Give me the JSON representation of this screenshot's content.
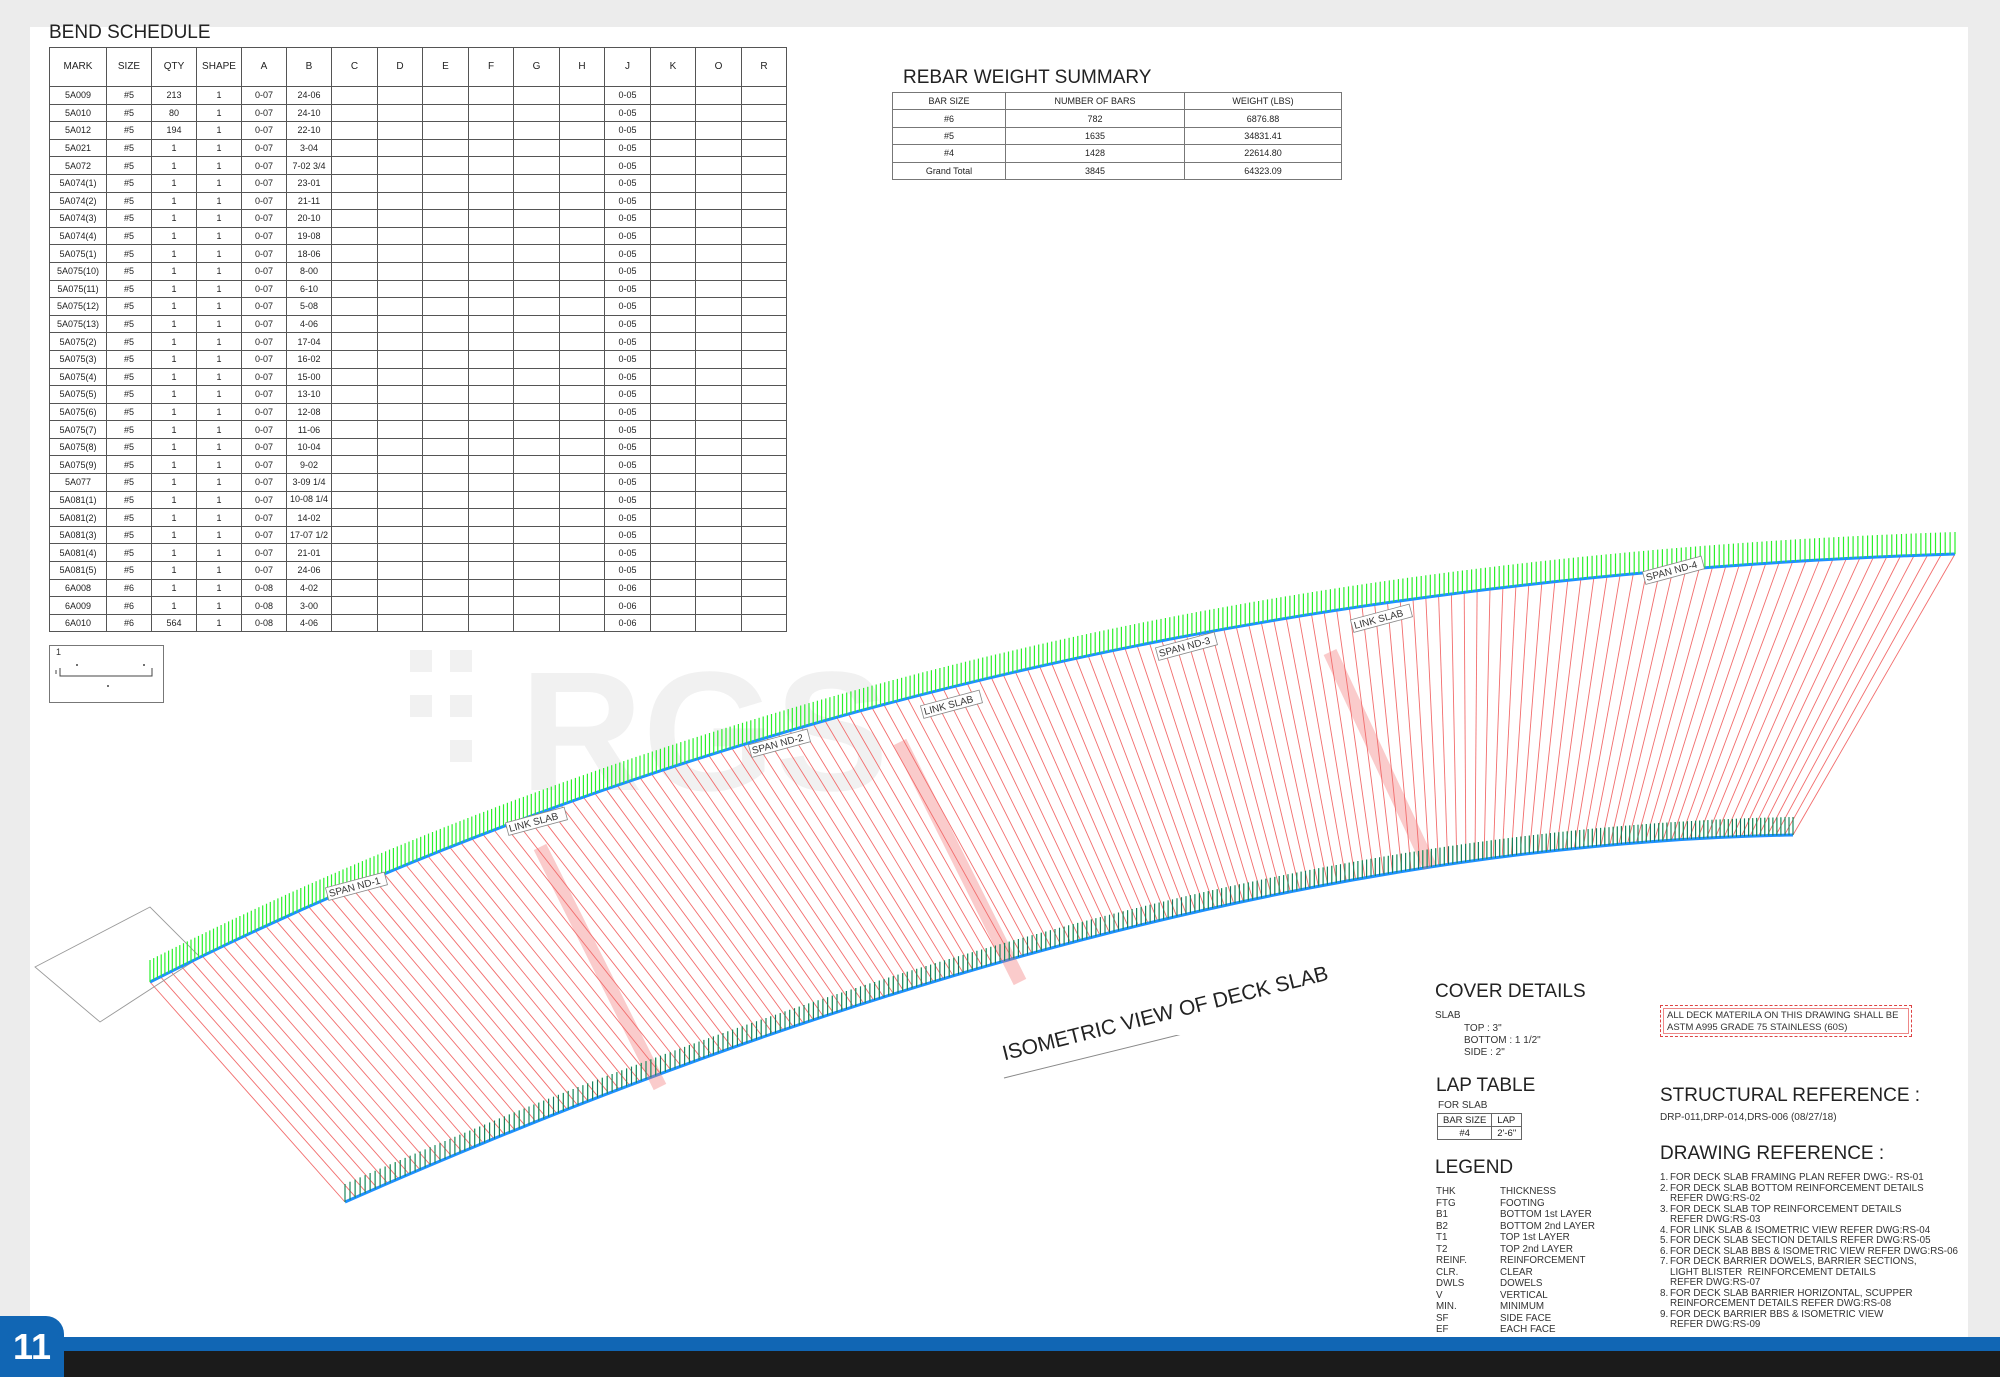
{
  "bend_schedule": {
    "title": "BEND SCHEDULE",
    "columns": [
      "MARK",
      "SIZE",
      "QTY",
      "SHAPE",
      "A",
      "B",
      "C",
      "D",
      "E",
      "F",
      "G",
      "H",
      "J",
      "K",
      "O",
      "R"
    ],
    "rows": [
      [
        "5A009",
        "#5",
        "213",
        "1",
        "0-07",
        "24-06",
        "0-05"
      ],
      [
        "5A010",
        "#5",
        "80",
        "1",
        "0-07",
        "24-10",
        "0-05"
      ],
      [
        "5A012",
        "#5",
        "194",
        "1",
        "0-07",
        "22-10",
        "0-05"
      ],
      [
        "5A021",
        "#5",
        "1",
        "1",
        "0-07",
        "3-04",
        "0-05"
      ],
      [
        "5A072",
        "#5",
        "1",
        "1",
        "0-07",
        "7-02 3/4",
        "0-05"
      ],
      [
        "5A074(1)",
        "#5",
        "1",
        "1",
        "0-07",
        "23-01",
        "0-05"
      ],
      [
        "5A074(2)",
        "#5",
        "1",
        "1",
        "0-07",
        "21-11",
        "0-05"
      ],
      [
        "5A074(3)",
        "#5",
        "1",
        "1",
        "0-07",
        "20-10",
        "0-05"
      ],
      [
        "5A074(4)",
        "#5",
        "1",
        "1",
        "0-07",
        "19-08",
        "0-05"
      ],
      [
        "5A075(1)",
        "#5",
        "1",
        "1",
        "0-07",
        "18-06",
        "0-05"
      ],
      [
        "5A075(10)",
        "#5",
        "1",
        "1",
        "0-07",
        "8-00",
        "0-05"
      ],
      [
        "5A075(11)",
        "#5",
        "1",
        "1",
        "0-07",
        "6-10",
        "0-05"
      ],
      [
        "5A075(12)",
        "#5",
        "1",
        "1",
        "0-07",
        "5-08",
        "0-05"
      ],
      [
        "5A075(13)",
        "#5",
        "1",
        "1",
        "0-07",
        "4-06",
        "0-05"
      ],
      [
        "5A075(2)",
        "#5",
        "1",
        "1",
        "0-07",
        "17-04",
        "0-05"
      ],
      [
        "5A075(3)",
        "#5",
        "1",
        "1",
        "0-07",
        "16-02",
        "0-05"
      ],
      [
        "5A075(4)",
        "#5",
        "1",
        "1",
        "0-07",
        "15-00",
        "0-05"
      ],
      [
        "5A075(5)",
        "#5",
        "1",
        "1",
        "0-07",
        "13-10",
        "0-05"
      ],
      [
        "5A075(6)",
        "#5",
        "1",
        "1",
        "0-07",
        "12-08",
        "0-05"
      ],
      [
        "5A075(7)",
        "#5",
        "1",
        "1",
        "0-07",
        "11-06",
        "0-05"
      ],
      [
        "5A075(8)",
        "#5",
        "1",
        "1",
        "0-07",
        "10-04",
        "0-05"
      ],
      [
        "5A075(9)",
        "#5",
        "1",
        "1",
        "0-07",
        "9-02",
        "0-05"
      ],
      [
        "5A077",
        "#5",
        "1",
        "1",
        "0-07",
        "3-09 1/4",
        "0-05"
      ],
      [
        "5A081(1)",
        "#5",
        "1",
        "1",
        "0-07",
        "10-08 1/4",
        "0-05"
      ],
      [
        "5A081(2)",
        "#5",
        "1",
        "1",
        "0-07",
        "14-02",
        "0-05"
      ],
      [
        "5A081(3)",
        "#5",
        "1",
        "1",
        "0-07",
        "17-07 1/2",
        "0-05"
      ],
      [
        "5A081(4)",
        "#5",
        "1",
        "1",
        "0-07",
        "21-01",
        "0-05"
      ],
      [
        "5A081(5)",
        "#5",
        "1",
        "1",
        "0-07",
        "24-06",
        "0-05"
      ],
      [
        "6A008",
        "#6",
        "1",
        "1",
        "0-08",
        "4-02",
        "0-06"
      ],
      [
        "6A009",
        "#6",
        "1",
        "1",
        "0-08",
        "3-00",
        "0-06"
      ],
      [
        "6A010",
        "#6",
        "564",
        "1",
        "0-08",
        "4-06",
        "0-06"
      ]
    ],
    "shape_label": "1"
  },
  "weight_summary": {
    "title": "REBAR WEIGHT SUMMARY",
    "columns": [
      "BAR SIZE",
      "NUMBER OF BARS",
      "WEIGHT (LBS)"
    ],
    "rows": [
      [
        "#6",
        "782",
        "6876.88"
      ],
      [
        "#5",
        "1635",
        "34831.41"
      ],
      [
        "#4",
        "1428",
        "22614.80"
      ],
      [
        "Grand Total",
        "3845",
        "64323.09"
      ]
    ]
  },
  "drawing": {
    "title": "ISOMETRIC VIEW OF DECK SLAB",
    "labels": [
      "SPAN ND-1",
      "LINK SLAB",
      "SPAN ND-2",
      "LINK SLAB",
      "SPAN ND-3",
      "LINK SLAB",
      "SPAN ND-4"
    ],
    "colors": {
      "bars": "#f26d6d",
      "top_bars": "#2bf02b",
      "edge": "#1e90ff",
      "dark": "#0a1f8f"
    }
  },
  "cover_details": {
    "title": "COVER DETAILS",
    "subtitle": "SLAB",
    "lines": [
      "TOP : 3\"",
      "BOTTOM : 1 1/2\"",
      "SIDE : 2\""
    ]
  },
  "material_note": [
    "ALL DECK MATERILA ON THIS DRAWING SHALL BE",
    "ASTM A995 GRADE 75 STAINLESS (60S)"
  ],
  "lap_table": {
    "title": "LAP TABLE",
    "subtitle": "FOR SLAB",
    "headers": [
      "BAR SIZE",
      "LAP"
    ],
    "row": [
      "#4",
      "2'-6\""
    ]
  },
  "legend": {
    "title": "LEGEND",
    "items": [
      [
        "THK",
        "THICKNESS"
      ],
      [
        "FTG",
        "FOOTING"
      ],
      [
        "B1",
        "BOTTOM 1st LAYER"
      ],
      [
        "B2",
        "BOTTOM 2nd LAYER"
      ],
      [
        "T1",
        "TOP 1st LAYER"
      ],
      [
        "T2",
        "TOP 2nd LAYER"
      ],
      [
        "REINF.",
        "REINFORCEMENT"
      ],
      [
        "CLR.",
        "CLEAR"
      ],
      [
        "DWLS",
        "DOWELS"
      ],
      [
        "V",
        "VERTICAL"
      ],
      [
        "MIN.",
        "MINIMUM"
      ],
      [
        "SF",
        "SIDE FACE"
      ],
      [
        "EF",
        "EACH FACE"
      ]
    ]
  },
  "structural_reference": {
    "title": "STRUCTURAL REFERENCE :",
    "text": "DRP-011,DRP-014,DRS-006 (08/27/18)"
  },
  "drawing_reference": {
    "title": "DRAWING REFERENCE :",
    "items": [
      [
        "1.",
        "FOR DECK SLAB FRAMING PLAN REFER DWG:- RS-01"
      ],
      [
        "2.",
        "FOR DECK SLAB BOTTOM REINFORCEMENT DETAILS"
      ],
      [
        "",
        "REFER DWG:RS-02"
      ],
      [
        "3.",
        "FOR DECK SLAB TOP REINFORCEMENT DETAILS"
      ],
      [
        "",
        "REFER DWG:RS-03"
      ],
      [
        "4.",
        "FOR LINK SLAB & ISOMETRIC VIEW REFER DWG:RS-04"
      ],
      [
        "5.",
        "FOR DECK SLAB SECTION DETAILS REFER DWG:RS-05"
      ],
      [
        "6.",
        "FOR DECK SLAB BBS & ISOMETRIC VIEW REFER DWG:RS-06"
      ],
      [
        "7.",
        "FOR DECK BARRIER DOWELS, BARRIER SECTIONS,"
      ],
      [
        "",
        "LIGHT BLISTER  REINFORCEMENT DETAILS"
      ],
      [
        "",
        "REFER DWG:RS-07"
      ],
      [
        "8.",
        "FOR DECK SLAB BARRIER HORIZONTAL, SCUPPER"
      ],
      [
        "",
        "REINFORCEMENT DETAILS REFER DWG:RS-08"
      ],
      [
        "9.",
        "FOR DECK BARRIER BBS & ISOMETRIC VIEW"
      ],
      [
        "",
        "REFER DWG:RS-09"
      ]
    ]
  },
  "page_number": "11"
}
